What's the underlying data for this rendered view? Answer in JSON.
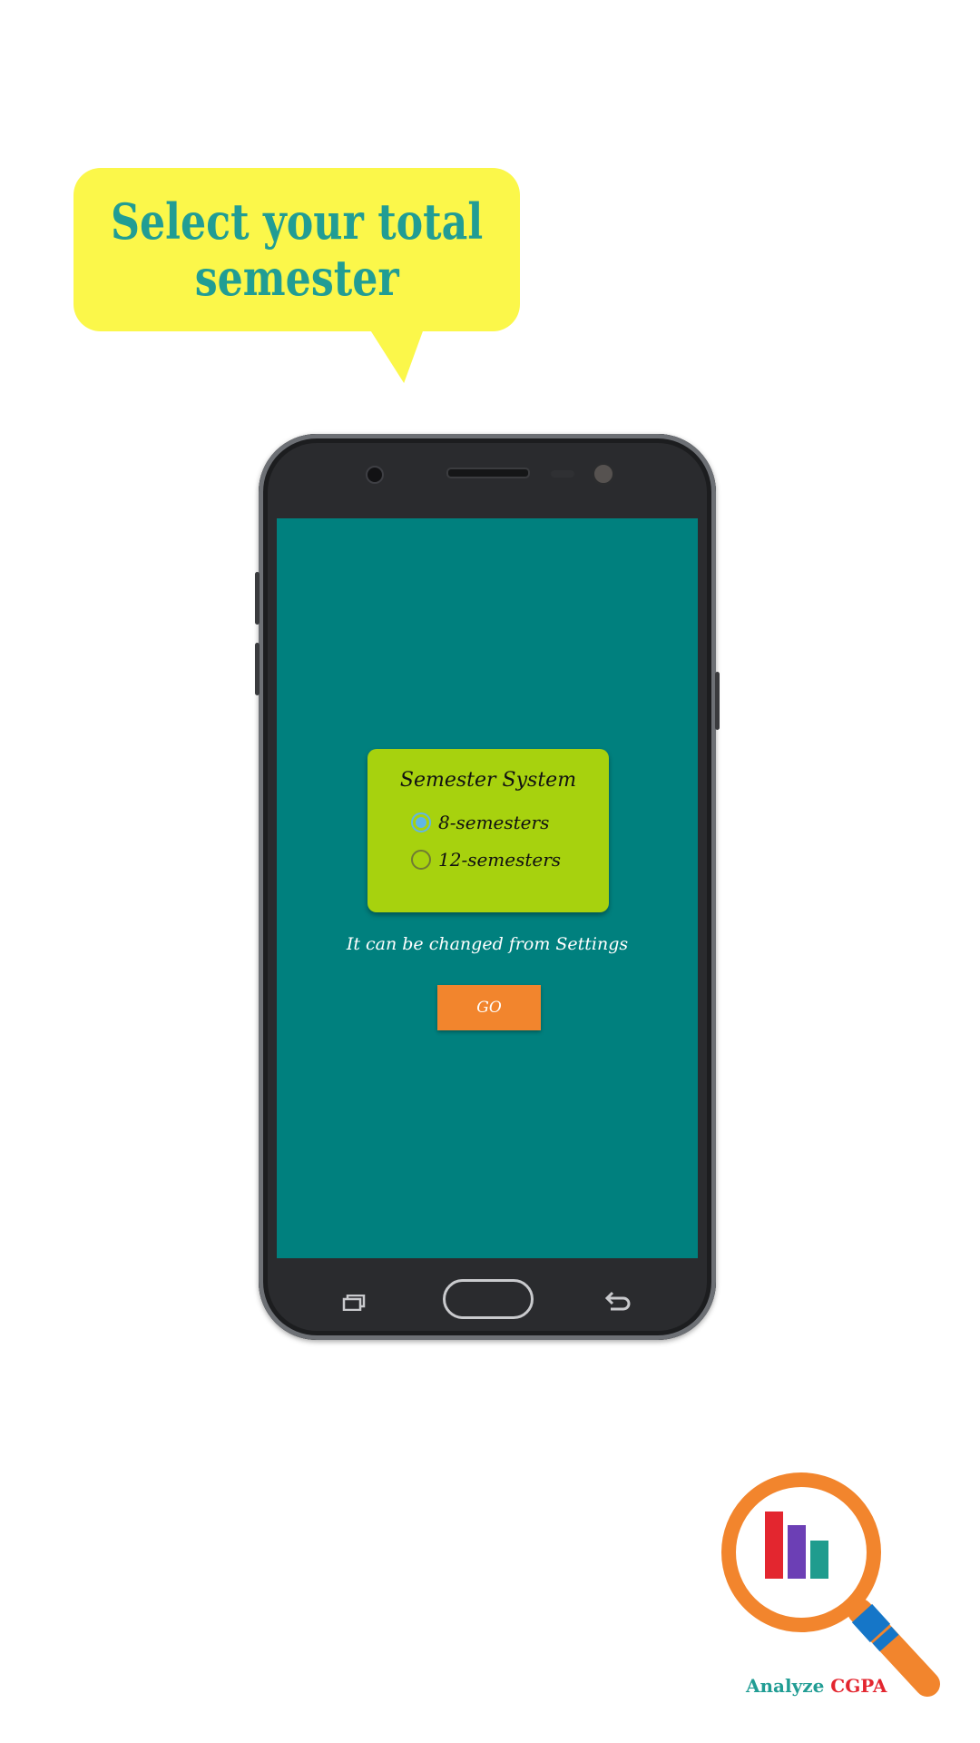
{
  "promo": {
    "headline_line1": "Select your total",
    "headline_line2": "semester"
  },
  "dialog": {
    "title": "Semester System",
    "options": [
      {
        "label": "8-semesters",
        "selected": true
      },
      {
        "label": "12-semesters",
        "selected": false
      }
    ]
  },
  "hint": "It can be changed from Settings",
  "go_button": "GO",
  "logo": {
    "word1": "Analyze",
    "word2": "CGPA"
  },
  "colors": {
    "screen_bg": "#00807e",
    "card_bg": "#a7d20e",
    "button_bg": "#f2852d",
    "bubble_bg": "#fbf74a",
    "headline": "#219d94",
    "radio_checked": "#60b6e6"
  },
  "icons": {
    "nav_recent": "recent-apps-icon",
    "nav_home": "home-button-icon",
    "nav_back": "back-arrow-icon",
    "logo": "magnifier-chart-icon"
  }
}
